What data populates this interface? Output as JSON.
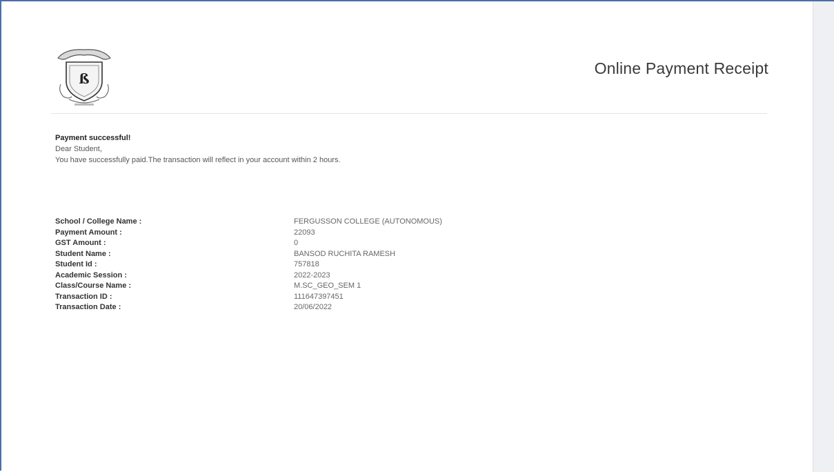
{
  "receipt": {
    "title": "Online Payment Receipt",
    "message": {
      "success": "Payment successful!",
      "greeting": "Dear Student,",
      "body": "You have successfully paid.The transaction will reflect in your account within 2 hours."
    },
    "details": [
      {
        "label": "School / College Name :",
        "value": "FERGUSSON COLLEGE (AUTONOMOUS)"
      },
      {
        "label": "Payment Amount :",
        "value": "22093"
      },
      {
        "label": "GST Amount :",
        "value": "0"
      },
      {
        "label": "Student Name :",
        "value": "BANSOD RUCHITA RAMESH"
      },
      {
        "label": "Student Id :",
        "value": "757818"
      },
      {
        "label": "Academic Session :",
        "value": "2022-2023"
      },
      {
        "label": "Class/Course Name :",
        "value": "M.SC_GEO_SEM 1"
      },
      {
        "label": "Transaction ID :",
        "value": "111647397451"
      },
      {
        "label": "Transaction Date :",
        "value": "20/06/2022"
      }
    ]
  },
  "colors": {
    "frame_border": "#4a6fa5",
    "gutter": "#eef0f3",
    "text_dark": "#333333",
    "text_muted": "#666666"
  },
  "icons": {
    "logo": "college-crest-logo"
  }
}
